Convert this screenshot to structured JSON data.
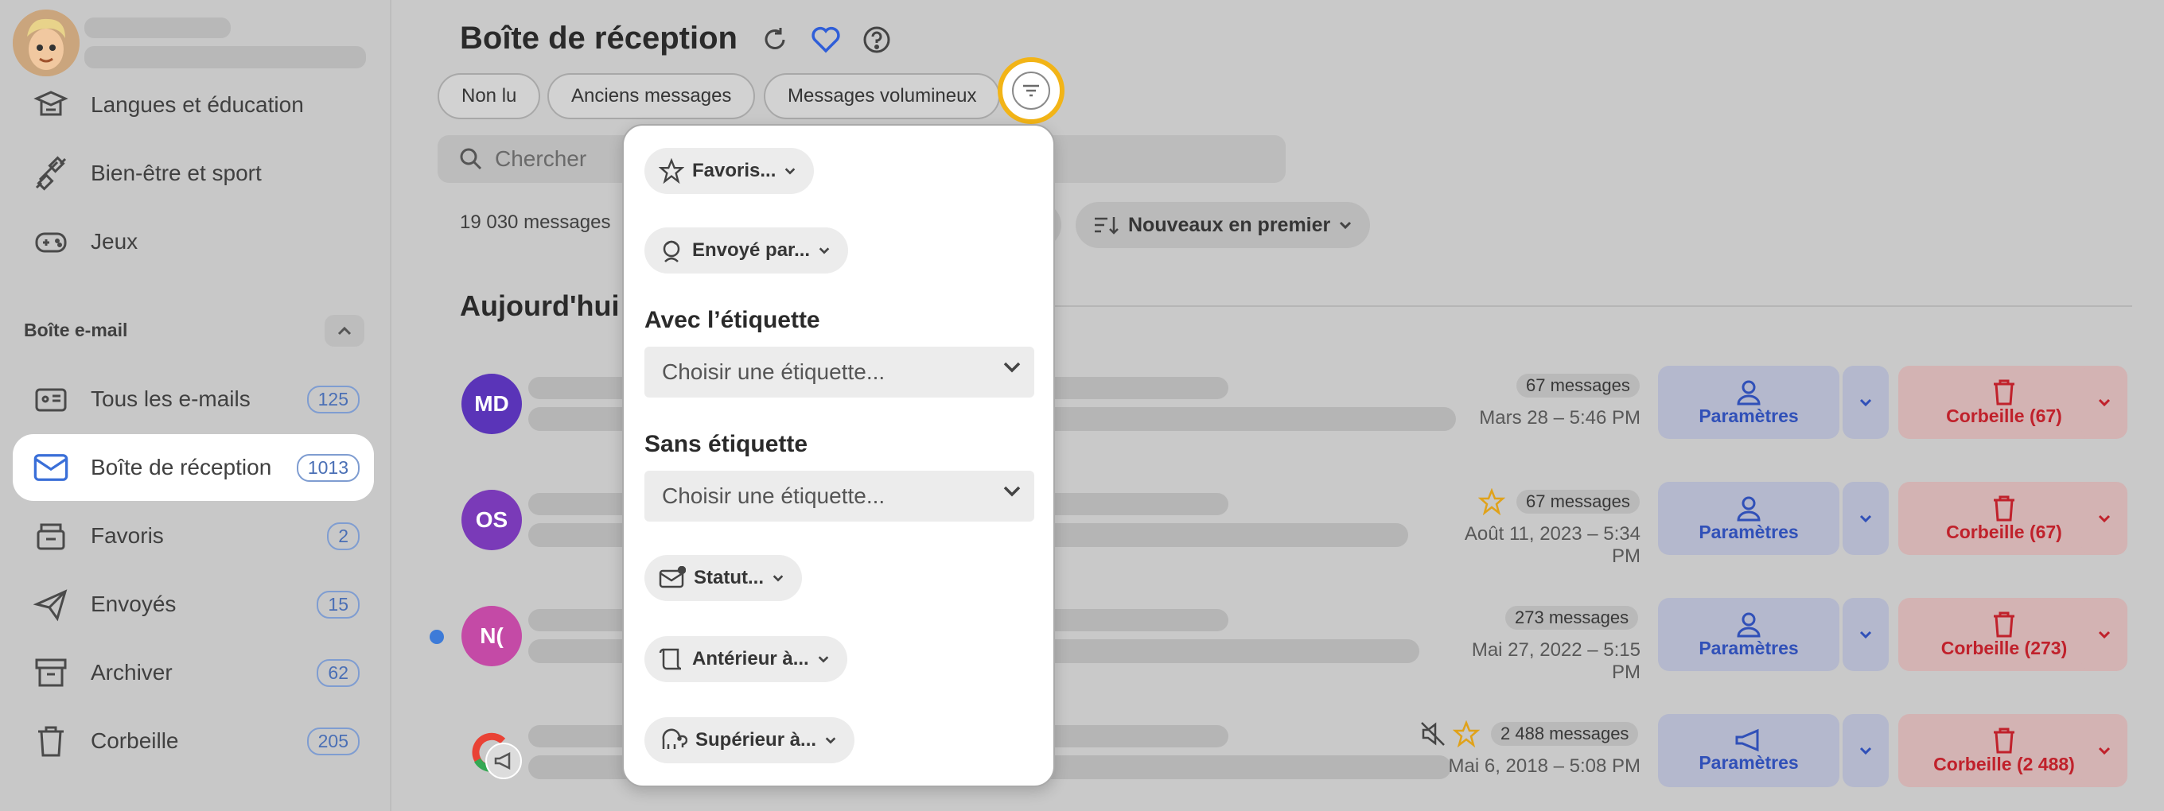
{
  "sidebar": {
    "items_top": [
      {
        "label": "Langues et éducation",
        "icon": "education-icon"
      },
      {
        "label": "Bien-être et sport",
        "icon": "dumbbell-icon"
      },
      {
        "label": "Jeux",
        "icon": "gamepad-icon"
      }
    ],
    "section_title": "Boîte e-mail",
    "mail_items": [
      {
        "label": "Tous les e-mails",
        "count": "125",
        "icon": "all-mail-icon"
      },
      {
        "label": "Boîte de réception",
        "count": "1013",
        "icon": "inbox-icon"
      },
      {
        "label": "Favoris",
        "count": "2",
        "icon": "favorites-icon"
      },
      {
        "label": "Envoyés",
        "count": "15",
        "icon": "sent-icon"
      },
      {
        "label": "Archiver",
        "count": "62",
        "icon": "archive-icon"
      },
      {
        "label": "Corbeille",
        "count": "205",
        "icon": "trash-icon"
      }
    ]
  },
  "header": {
    "title": "Boîte de réception",
    "chips": [
      "Non lu",
      "Anciens messages",
      "Messages volumineux"
    ]
  },
  "search": {
    "placeholder": "Chercher"
  },
  "list": {
    "count": "19 030 messages",
    "sort_label": "Nouveaux en premier",
    "group_title": "Aujourd'hui",
    "rows": [
      {
        "initials": "MD",
        "color": "#5a34b8",
        "messages": "67 messages",
        "date": "Mars 28 – 5:46 PM",
        "param": "Paramètres",
        "trash": "Corbeille (67)"
      },
      {
        "initials": "OS",
        "color": "#7a3ab8",
        "messages": "67 messages",
        "date": "Août 11, 2023 – 5:34 PM",
        "param": "Paramètres",
        "trash": "Corbeille (67)"
      },
      {
        "initials": "N(",
        "color": "#c44aa6",
        "messages": "273 messages",
        "date": "Mai 27, 2022 – 5:15 PM",
        "param": "Paramètres",
        "trash": "Corbeille (273)"
      },
      {
        "initials": "G",
        "color": "#ffffff",
        "messages": "2 488 messages",
        "date": "Mai 6, 2018 – 5:08 PM",
        "param": "Paramètres",
        "trash": "Corbeille (2 488)"
      }
    ]
  },
  "filter_popup": {
    "favorites": "Favoris...",
    "sent_by": "Envoyé par...",
    "with_label_title": "Avec l’étiquette",
    "with_label_placeholder": "Choisir une étiquette...",
    "without_label_title": "Sans étiquette",
    "without_label_placeholder": "Choisir une étiquette...",
    "status": "Statut...",
    "before": "Antérieur à...",
    "larger": "Supérieur à..."
  },
  "colors": {
    "accent": "#f2b417",
    "link": "#3050b8",
    "danger": "#c0212b"
  }
}
